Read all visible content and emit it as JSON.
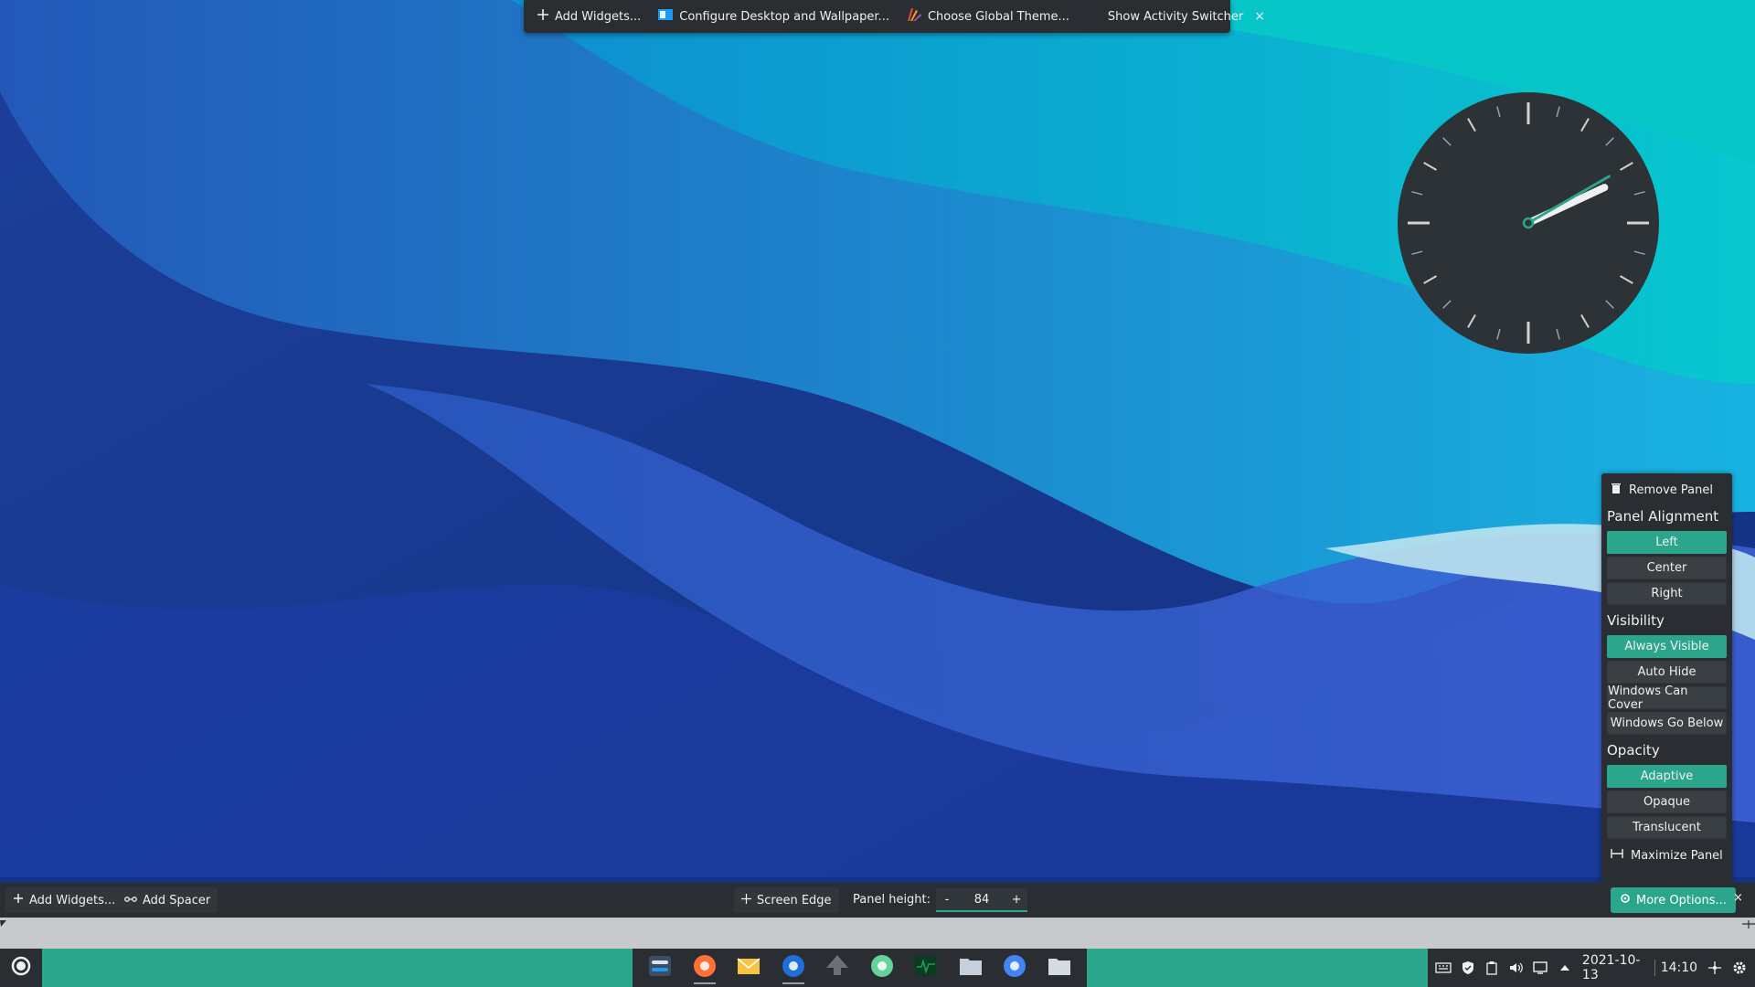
{
  "top_toolbar": {
    "add_widgets": "Add Widgets...",
    "configure_desktop": "Configure Desktop and Wallpaper...",
    "choose_theme": "Choose Global Theme...",
    "activity_switcher": "Show Activity Switcher",
    "close": "×"
  },
  "clock": {
    "hours": 2,
    "minutes": 10
  },
  "panel_menu": {
    "remove_panel": "Remove Panel",
    "alignment_heading": "Panel Alignment",
    "alignment": [
      "Left",
      "Center",
      "Right"
    ],
    "alignment_selected": "Left",
    "visibility_heading": "Visibility",
    "visibility": [
      "Always Visible",
      "Auto Hide",
      "Windows Can Cover",
      "Windows Go Below"
    ],
    "visibility_selected": "Always Visible",
    "opacity_heading": "Opacity",
    "opacity": [
      "Adaptive",
      "Opaque",
      "Translucent"
    ],
    "opacity_selected": "Adaptive",
    "maximize_panel": "Maximize Panel"
  },
  "edit_bar": {
    "add_widgets": "Add Widgets...",
    "add_spacer": "Add Spacer",
    "screen_edge": "Screen Edge",
    "panel_height_label": "Panel height:",
    "panel_height_value": "84",
    "minus": "-",
    "plus": "+",
    "more_options": "More Options...",
    "close": "×"
  },
  "taskbar": {
    "tasks": [
      {
        "name": "system-settings",
        "color": "#dfe3e8"
      },
      {
        "name": "firefox",
        "color": "#ff7139"
      },
      {
        "name": "mail",
        "color": "#f6c343"
      },
      {
        "name": "browser-blue",
        "color": "#1e6fd9"
      },
      {
        "name": "inkscape",
        "color": "#6c7076"
      },
      {
        "name": "atom",
        "color": "#66d39a"
      },
      {
        "name": "system-monitor",
        "color": "#1f9d55"
      },
      {
        "name": "file-manager",
        "color": "#c6d0da"
      },
      {
        "name": "chrome",
        "color": "#4285f4"
      },
      {
        "name": "folder",
        "color": "#d4dbe2"
      }
    ],
    "tray": {
      "date": "2021-10-13",
      "time": "14:10"
    }
  },
  "colors": {
    "accent": "#2ca58d",
    "panel_bg": "#2a2e32"
  }
}
